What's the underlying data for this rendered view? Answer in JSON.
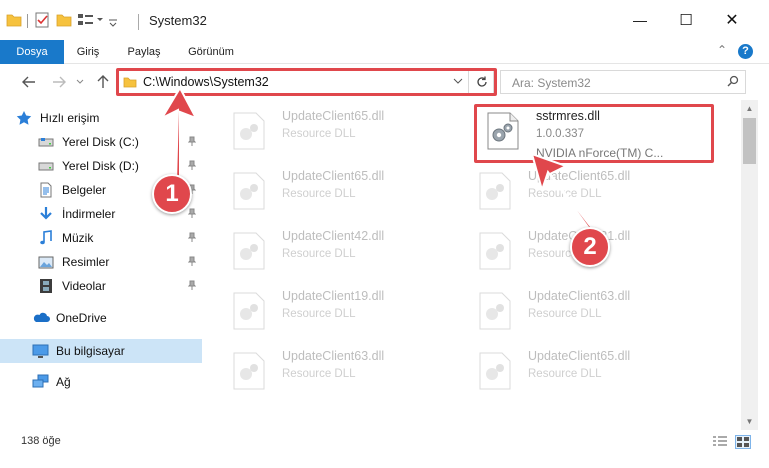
{
  "window": {
    "title": "System32",
    "minimize_label": "—",
    "maximize_label": "☐",
    "close_label": "✕"
  },
  "ribbon": {
    "tabs": [
      {
        "label": "Dosya"
      },
      {
        "label": "Giriş"
      },
      {
        "label": "Paylaş"
      },
      {
        "label": "Görünüm"
      }
    ],
    "collapse_label": "⌃",
    "help_label": "?"
  },
  "address": {
    "path": "C:\\Windows\\System32",
    "search_placeholder": "Ara: System32"
  },
  "sidebar": {
    "quick_access": "Hızlı erişim",
    "items": [
      {
        "label": "Yerel Disk (C:)"
      },
      {
        "label": "Yerel Disk (D:)"
      },
      {
        "label": "Belgeler"
      },
      {
        "label": "İndirmeler"
      },
      {
        "label": "Müzik"
      },
      {
        "label": "Resimler"
      },
      {
        "label": "Videolar"
      }
    ],
    "onedrive": "OneDrive",
    "this_pc": "Bu bilgisayar",
    "network": "Ağ"
  },
  "files": [
    {
      "name": "UpdateClient65.dll",
      "type": "Resource DLL"
    },
    {
      "name": "sstrmres.dll",
      "version": "1.0.0.337",
      "desc": "NVIDIA nForce(TM) C..."
    },
    {
      "name": "UpdateClient65.dll",
      "type": "Resource DLL"
    },
    {
      "name": "UpdateClient65.dll",
      "type": "Resource DLL"
    },
    {
      "name": "UpdateClient42.dll",
      "type": "Resource DLL"
    },
    {
      "name": "UpdateClient21.dll",
      "type": "Resource DLL"
    },
    {
      "name": "UpdateClient19.dll",
      "type": "Resource DLL"
    },
    {
      "name": "UpdateClient63.dll",
      "type": "Resource DLL"
    },
    {
      "name": "UpdateClient63.dll",
      "type": "Resource DLL"
    },
    {
      "name": "UpdateClient65.dll",
      "type": "Resource DLL"
    }
  ],
  "status": {
    "count": "138 öğe"
  },
  "callouts": {
    "one": "1",
    "two": "2"
  },
  "colors": {
    "accent": "#1979ca",
    "highlight": "#e0474c",
    "selected_nav": "#cce4f7"
  }
}
